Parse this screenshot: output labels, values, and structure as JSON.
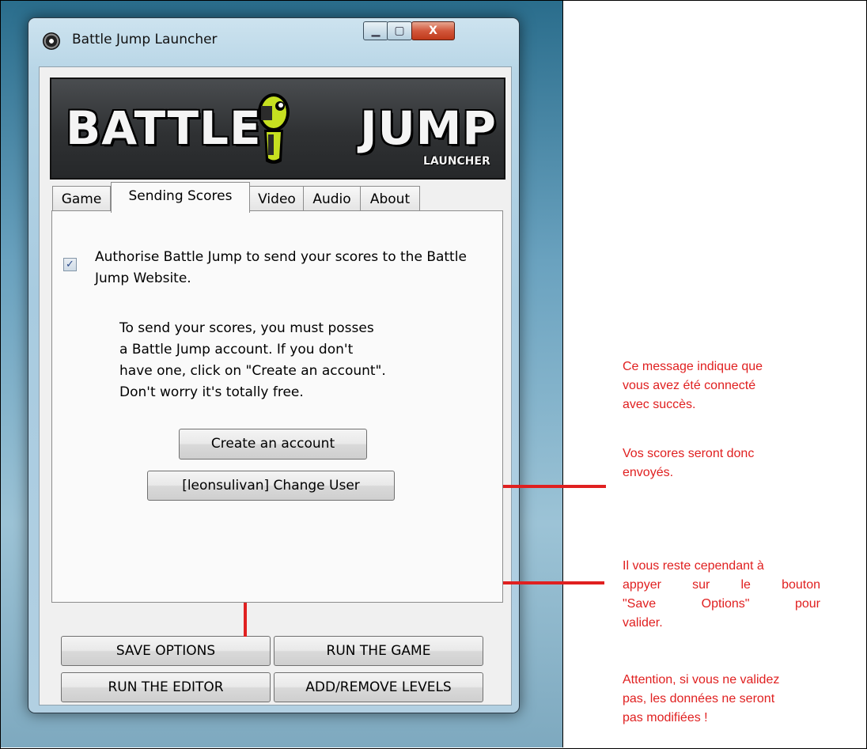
{
  "window": {
    "title": "Battle Jump Launcher",
    "minimize": "▁",
    "maximize": "▢",
    "close": "X"
  },
  "banner": {
    "word1": "BATTLE",
    "word2": "JUMP",
    "subtitle": "LAUNCHER"
  },
  "tabs": [
    "Game",
    "Sending Scores",
    "Video",
    "Audio",
    "About"
  ],
  "sending_scores": {
    "authorise_checked": true,
    "authorise_label": "Authorise Battle Jump to send your scores to the Battle Jump Website.",
    "info_lines": [
      "To send your scores, you must posses",
      "a Battle Jump account. If you don't",
      "have one, click on \"Create an account\".",
      "Don't worry it's totally free."
    ],
    "create_account_label": "Create an account",
    "change_user_label": "[leonsulivan] Change User"
  },
  "bottom_buttons": {
    "save": "SAVE OPTIONS",
    "run_game": "RUN THE GAME",
    "run_editor": "RUN THE EDITOR",
    "add_remove": "ADD/REMOVE LEVELS"
  },
  "annotations": {
    "note1": [
      "Ce message indique que",
      "vous avez été connecté",
      "avec succès."
    ],
    "note2": [
      "Vos scores seront donc",
      "envoyés."
    ],
    "note3": [
      "Il vous reste cependant à",
      "appyer sur le bouton",
      "\"Save Options\" pour",
      "valider."
    ],
    "note4": [
      "Attention, si vous ne validez",
      "pas, les données ne seront",
      "pas modifiées !"
    ],
    "color": "#e02020"
  }
}
